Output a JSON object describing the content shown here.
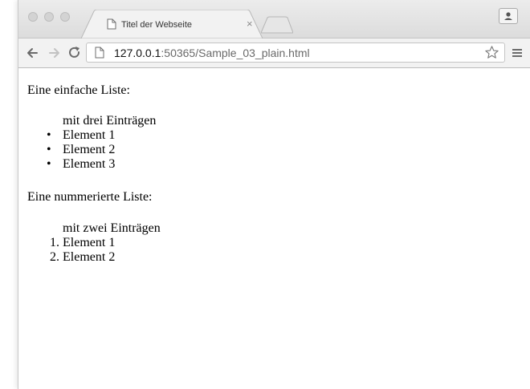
{
  "browser": {
    "tab_title": "Titel der Webseite",
    "tab_close_glyph": "×",
    "url_host": "127.0.0.1",
    "url_rest": ":50365/Sample_03_plain.html"
  },
  "page": {
    "ul_heading": "Eine einfache Liste:",
    "ul_caption": "mit drei Einträgen",
    "ul_items": [
      "Element 1",
      "Element 2",
      "Element 3"
    ],
    "ol_heading": "Eine nummerierte Liste:",
    "ol_caption": "mit zwei Einträgen",
    "ol_items": [
      "Element 1",
      "Element 2"
    ],
    "ol_numbers": [
      "1.",
      "2."
    ],
    "bullet_glyph": "•"
  },
  "icons": [
    "page-icon",
    "back-arrow-icon",
    "forward-arrow-icon",
    "reload-icon",
    "bookmark-star-icon",
    "menu-icon",
    "profile-icon"
  ]
}
